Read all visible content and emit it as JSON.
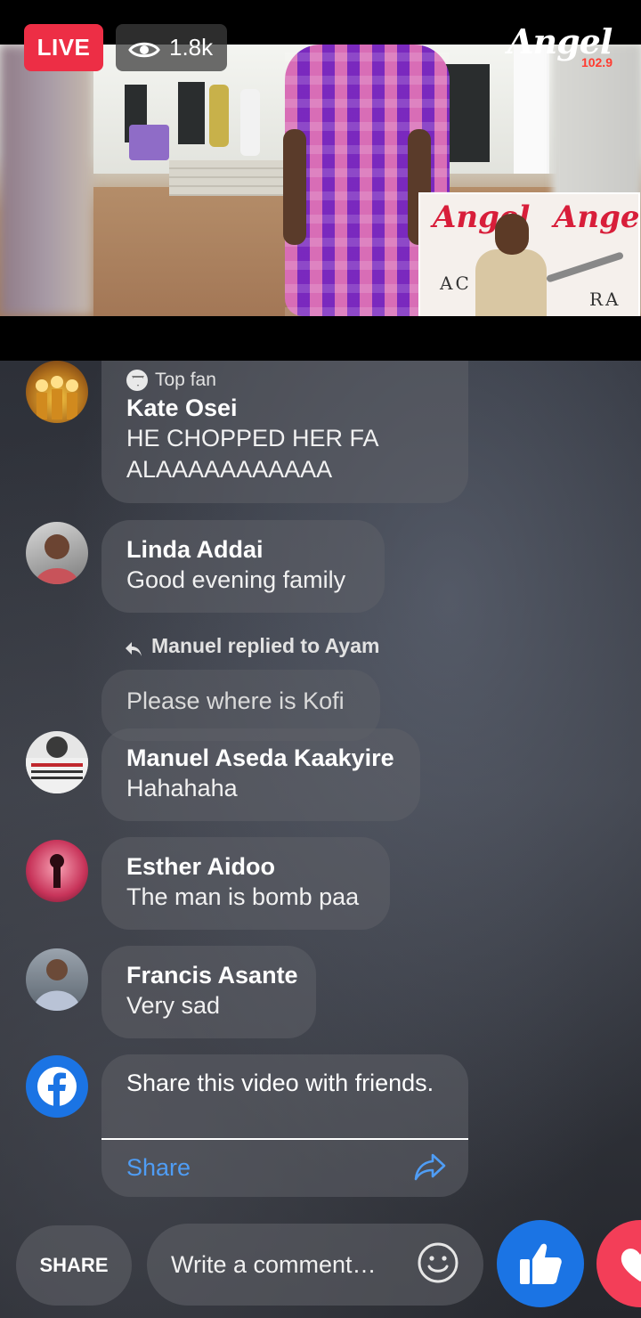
{
  "stream": {
    "live_label": "LIVE",
    "viewer_count": "1.8k",
    "station_logo_text": "Angel",
    "station_frequency": "102.9"
  },
  "comments": [
    {
      "badge": "Top fan",
      "name": "Kate Osei",
      "text": "HE CHOPPED HER FAALAAAAAAAAAAA"
    },
    {
      "name": "Linda Addai",
      "text": "Good evening family"
    },
    {
      "reply_context": "Manuel replied to Ayam",
      "quoted_text": "Please where is Kofi",
      "name": "Manuel Aseda Kaakyire",
      "text": "Hahahaha"
    },
    {
      "name": "Esther Aidoo",
      "text": "The man is bomb paa"
    },
    {
      "name": "Francis Asante",
      "text": "Very sad"
    }
  ],
  "share_prompt": {
    "message": "Share this video with friends.",
    "action_label": "Share"
  },
  "bottom_bar": {
    "share_button_label": "SHARE",
    "comment_placeholder": "Write a comment…"
  },
  "icons": {
    "viewers": "eye-icon",
    "top_fan": "diamond-icon",
    "reply": "reply-arrow-icon",
    "facebook": "facebook-icon",
    "share": "share-arrow-icon",
    "emoji": "emoji-icon",
    "like": "thumbs-up-icon",
    "love": "heart-icon"
  },
  "colors": {
    "live_red": "#ed2e45",
    "facebook_blue": "#1b74e4",
    "link_blue": "#4f9df5",
    "love_red": "#f33e58"
  }
}
